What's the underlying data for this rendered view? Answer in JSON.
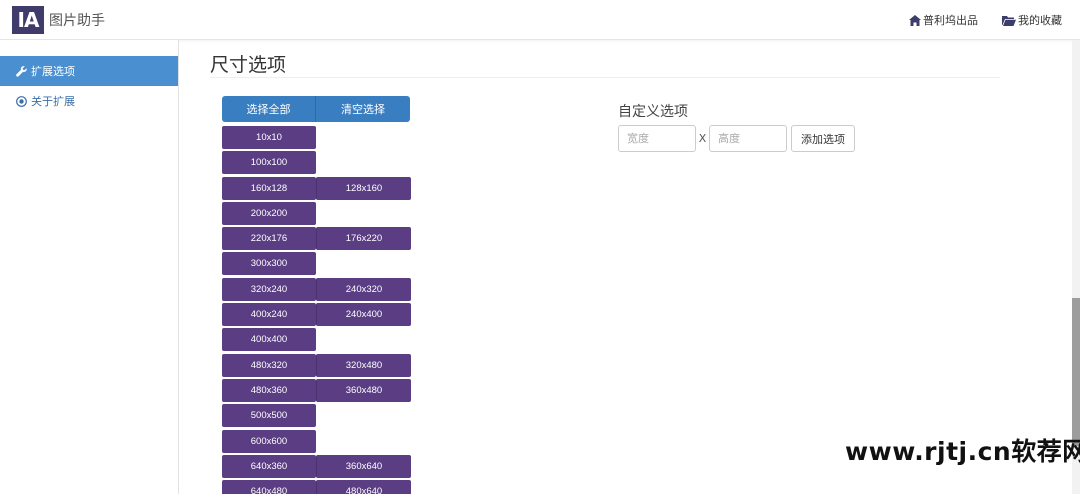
{
  "app": {
    "logo_text": "IA",
    "name": "图片助手"
  },
  "nav": {
    "links": [
      {
        "label": "普利坞出品",
        "icon": "home-icon"
      },
      {
        "label": "我的收藏",
        "icon": "folder-open-icon"
      }
    ]
  },
  "sidebar": {
    "items": [
      {
        "label": "扩展选项",
        "icon": "wrench-icon",
        "active": true
      },
      {
        "label": "关于扩展",
        "icon": "info-circle-icon",
        "active": false
      }
    ]
  },
  "main": {
    "title": "尺寸选项",
    "select_all_label": "选择全部",
    "clear_label": "清空选择",
    "sizes": [
      [
        "10x10"
      ],
      [
        "100x100"
      ],
      [
        "160x128",
        "128x160"
      ],
      [
        "200x200"
      ],
      [
        "220x176",
        "176x220"
      ],
      [
        "300x300"
      ],
      [
        "320x240",
        "240x320"
      ],
      [
        "400x240",
        "240x400"
      ],
      [
        "400x400"
      ],
      [
        "480x320",
        "320x480"
      ],
      [
        "480x360",
        "360x480"
      ],
      [
        "500x500"
      ],
      [
        "600x600"
      ],
      [
        "640x360",
        "360x640"
      ],
      [
        "640x480",
        "480x640"
      ]
    ]
  },
  "custom": {
    "title": "自定义选项",
    "width_placeholder": "宽度",
    "height_placeholder": "高度",
    "separator": "X",
    "add_label": "添加选项"
  },
  "watermark": "www.rjtj.cn软荐网",
  "colors": {
    "primary_blue": "#3a7ec2",
    "size_purple": "#5a3d83",
    "sidebar_active": "#4a8fd0",
    "link_blue": "#3a6ea8",
    "logo_bg": "#3f3b6b"
  }
}
